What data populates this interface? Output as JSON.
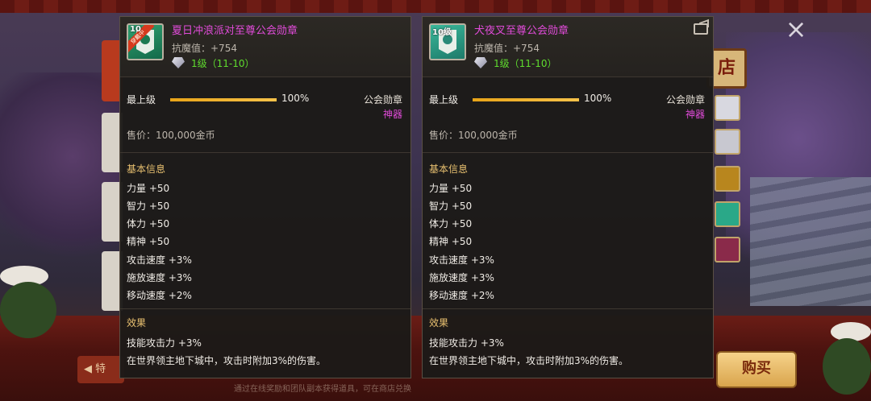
{
  "background": {
    "shop_sign": "店",
    "close_glyph": "×",
    "buy_label": "购买",
    "prev_label": "特",
    "bottom_tip": "通过在线奖励和团队副本获得道具，可在商店兑换"
  },
  "panels": [
    {
      "name": "夏日冲浪派对至尊公会勋章",
      "icon_level": "10",
      "icon_ribbon": "穿戴中",
      "resist": "抗魔值：+754",
      "level": "1级（11-10）",
      "top_label": "最上级",
      "progress": 1.0,
      "progress_text": "100%",
      "type_label": "公会勋章",
      "grade_label": "神器",
      "price": "售价：100,000金币",
      "basic_title": "基本信息",
      "stats": [
        "力量 +50",
        "智力 +50",
        "体力 +50",
        "精神 +50",
        "攻击速度 +3%",
        "施放速度 +3%",
        "移动速度 +2%"
      ],
      "effect_title": "效果",
      "effects": [
        "技能攻击力 +3%",
        "在世界领主地下城中，攻击时附加3%的伤害。"
      ]
    },
    {
      "name": "犬夜叉至尊公会勋章",
      "icon_level": "10级",
      "resist": "抗魔值：+754",
      "level": "1级（11-10）",
      "top_label": "最上级",
      "progress": 1.0,
      "progress_text": "100%",
      "type_label": "公会勋章",
      "grade_label": "神器",
      "price": "售价：100,000金币",
      "basic_title": "基本信息",
      "stats": [
        "力量 +50",
        "智力 +50",
        "体力 +50",
        "精神 +50",
        "攻击速度 +3%",
        "施放速度 +3%",
        "移动速度 +2%"
      ],
      "effect_title": "效果",
      "effects": [
        "技能攻击力 +3%",
        "在世界领主地下城中，攻击时附加3%的伤害。"
      ]
    }
  ],
  "colors": {
    "name": "#e04bd8",
    "level": "#5fdc2e",
    "section_title": "#e8c070",
    "progress": "#f6c24a"
  }
}
